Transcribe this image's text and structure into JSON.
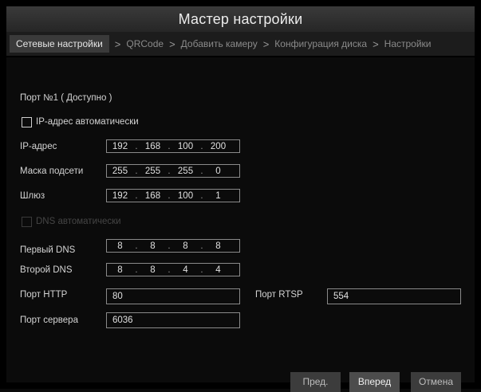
{
  "window": {
    "title": "Мастер настройки"
  },
  "steps": [
    {
      "label": "Сетевые настройки"
    },
    {
      "label": "QRCode"
    },
    {
      "label": "Добавить камеру"
    },
    {
      "label": "Конфигурация диска"
    },
    {
      "label": "Настройки"
    }
  ],
  "step_separator": ">",
  "form": {
    "port_label": "Порт №1 ( Доступно )",
    "dhcp": {
      "label": "IP-адрес автоматически",
      "checked": false
    },
    "ip": {
      "label": "IP-адрес",
      "octets": [
        "192",
        "168",
        "100",
        "200"
      ]
    },
    "mask": {
      "label": "Маска подсети",
      "octets": [
        "255",
        "255",
        "255",
        "0"
      ]
    },
    "gateway": {
      "label": "Шлюз",
      "octets": [
        "192",
        "168",
        "100",
        "1"
      ]
    },
    "dns_auto": {
      "label": "DNS автоматически",
      "checked": false,
      "disabled": true
    },
    "dns1": {
      "label": "Первый DNS",
      "octets": [
        "8",
        "8",
        "8",
        "8"
      ]
    },
    "dns2": {
      "label": "Второй DNS",
      "octets": [
        "8",
        "8",
        "4",
        "4"
      ]
    },
    "http_port": {
      "label": "Порт HTTP",
      "value": "80"
    },
    "rtsp_port": {
      "label": "Порт RTSP",
      "value": "554"
    },
    "server_port": {
      "label": "Порт сервера",
      "value": "6036"
    }
  },
  "buttons": {
    "prev": "Пред.",
    "next": "Вперед",
    "cancel": "Отмена"
  },
  "colors": {
    "background": "#000000",
    "title_bar": "#2e2e2e",
    "active_step": "#3a3a3a",
    "text": "#d8d8d8"
  }
}
